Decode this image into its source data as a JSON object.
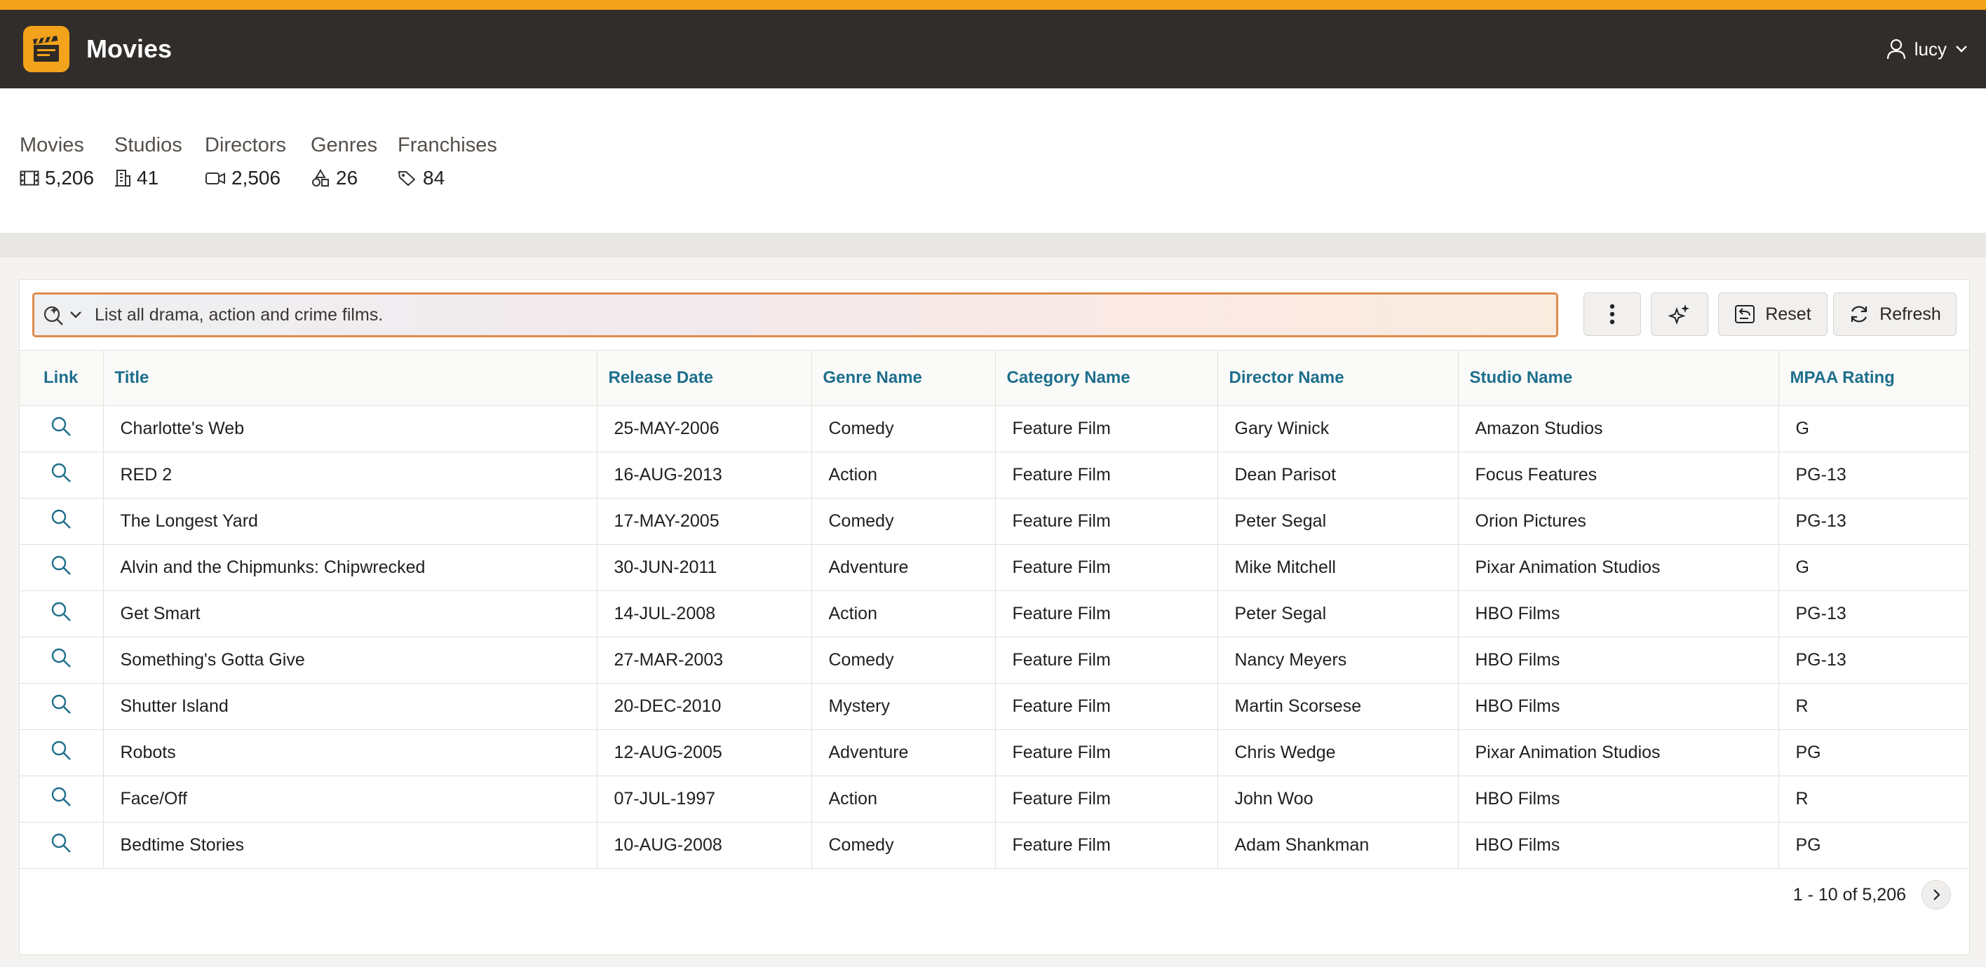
{
  "app": {
    "title": "Movies",
    "logo_icon": "clapperboard-icon",
    "accent_color": "#f2a31b",
    "header_color": "#312d2a"
  },
  "user": {
    "name": "lucy"
  },
  "stats": [
    {
      "label": "Movies",
      "value": "5,206",
      "icon": "film-icon"
    },
    {
      "label": "Studios",
      "value": "41",
      "icon": "building-icon"
    },
    {
      "label": "Directors",
      "value": "2,506",
      "icon": "video-camera-icon"
    },
    {
      "label": "Genres",
      "value": "26",
      "icon": "shapes-icon"
    },
    {
      "label": "Franchises",
      "value": "84",
      "icon": "tag-icon"
    }
  ],
  "search": {
    "value": "List all drama, action and crime films."
  },
  "toolbar": {
    "reset_label": "Reset",
    "refresh_label": "Refresh"
  },
  "table": {
    "columns": [
      "Link",
      "Title",
      "Release Date",
      "Genre Name",
      "Category Name",
      "Director Name",
      "Studio Name",
      "MPAA Rating"
    ],
    "rows": [
      [
        "Charlotte's Web",
        "25-MAY-2006",
        "Comedy",
        "Feature Film",
        "Gary Winick",
        "Amazon Studios",
        "G"
      ],
      [
        "RED 2",
        "16-AUG-2013",
        "Action",
        "Feature Film",
        "Dean Parisot",
        "Focus Features",
        "PG-13"
      ],
      [
        "The Longest Yard",
        "17-MAY-2005",
        "Comedy",
        "Feature Film",
        "Peter Segal",
        "Orion Pictures",
        "PG-13"
      ],
      [
        "Alvin and the Chipmunks: Chipwrecked",
        "30-JUN-2011",
        "Adventure",
        "Feature Film",
        "Mike Mitchell",
        "Pixar Animation Studios",
        "G"
      ],
      [
        "Get Smart",
        "14-JUL-2008",
        "Action",
        "Feature Film",
        "Peter Segal",
        "HBO Films",
        "PG-13"
      ],
      [
        "Something's Gotta Give",
        "27-MAR-2003",
        "Comedy",
        "Feature Film",
        "Nancy Meyers",
        "HBO Films",
        "PG-13"
      ],
      [
        "Shutter Island",
        "20-DEC-2010",
        "Mystery",
        "Feature Film",
        "Martin Scorsese",
        "HBO Films",
        "R"
      ],
      [
        "Robots",
        "12-AUG-2005",
        "Adventure",
        "Feature Film",
        "Chris Wedge",
        "Pixar Animation Studios",
        "PG"
      ],
      [
        "Face/Off",
        "07-JUL-1997",
        "Action",
        "Feature Film",
        "John Woo",
        "HBO Films",
        "R"
      ],
      [
        "Bedtime Stories",
        "10-AUG-2008",
        "Comedy",
        "Feature Film",
        "Adam Shankman",
        "HBO Films",
        "PG"
      ]
    ]
  },
  "pagination": {
    "summary": "1 - 10 of 5,206"
  }
}
